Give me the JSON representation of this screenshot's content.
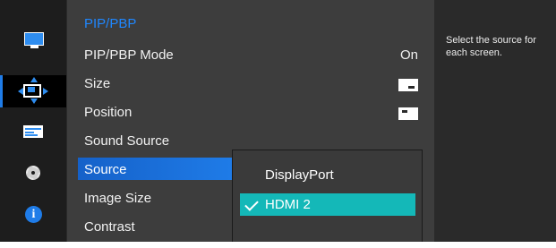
{
  "sidebar": {
    "icons": [
      "monitor-icon",
      "pip-pbp-icon",
      "system-icon",
      "gear-icon",
      "info-icon"
    ],
    "info_glyph": "i",
    "accent": "#1f7ce8"
  },
  "menu": {
    "title": "PIP/PBP",
    "items": [
      {
        "label": "PIP/PBP Mode",
        "value": "On"
      },
      {
        "label": "Size",
        "value_icon": "size-icon"
      },
      {
        "label": "Position",
        "value_icon": "position-icon"
      },
      {
        "label": "Sound Source"
      },
      {
        "label": "Source",
        "selected": true
      },
      {
        "label": "Image Size"
      },
      {
        "label": "Contrast"
      }
    ]
  },
  "submenu": {
    "options": [
      {
        "label": "DisplayPort",
        "selected": false
      },
      {
        "label": "HDMI 2",
        "selected": true
      }
    ],
    "selected_color": "#14b8b8"
  },
  "help": {
    "text": "Select the source for each screen."
  }
}
